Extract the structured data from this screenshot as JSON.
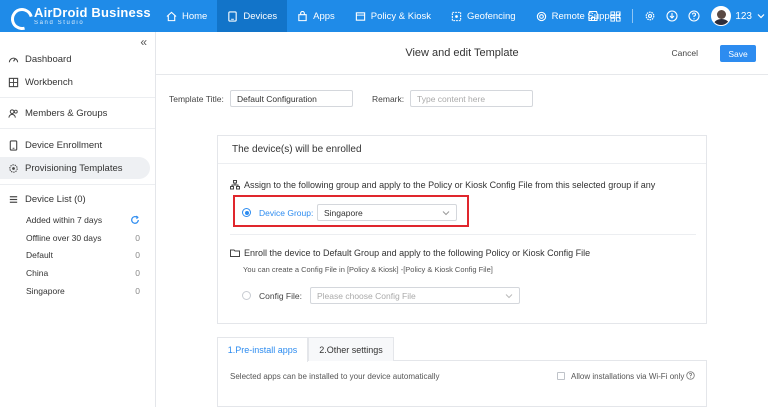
{
  "brand": {
    "name": "AirDroid Business",
    "sub": "Sand Studio"
  },
  "nav": [
    {
      "label": "Home",
      "icon": "home-icon"
    },
    {
      "label": "Devices",
      "icon": "devices-icon",
      "active": true
    },
    {
      "label": "Apps",
      "icon": "apps-icon"
    },
    {
      "label": "Policy & Kiosk",
      "icon": "policy-icon"
    },
    {
      "label": "Geofencing",
      "icon": "geofencing-icon"
    },
    {
      "label": "Remote Support",
      "icon": "remote-support-icon"
    }
  ],
  "user": {
    "name": "123"
  },
  "sidebar": {
    "items": [
      {
        "label": "Dashboard",
        "icon": "dashboard-icon"
      },
      {
        "label": "Workbench",
        "icon": "workbench-icon"
      },
      {
        "label": "Members & Groups",
        "icon": "members-icon"
      },
      {
        "label": "Device Enrollment",
        "icon": "enrollment-icon"
      },
      {
        "label": "Provisioning Templates",
        "icon": "templates-icon",
        "active": true
      },
      {
        "label": "Device List (0)",
        "icon": "device-list-icon"
      }
    ],
    "device_groups": [
      {
        "label": "Added within 7 days",
        "count": ""
      },
      {
        "label": "Offline over 30 days",
        "count": "0"
      },
      {
        "label": "Default",
        "count": "0"
      },
      {
        "label": "China",
        "count": "0"
      },
      {
        "label": "Singapore",
        "count": "0"
      }
    ]
  },
  "header": {
    "title": "View and edit Template",
    "cancel_label": "Cancel",
    "save_label": "Save"
  },
  "form": {
    "template_title_label": "Template Title:",
    "template_title_value": "Default Configuration",
    "remark_label": "Remark:",
    "remark_placeholder": "Type content here"
  },
  "enroll": {
    "heading": "The device(s) will be enrolled",
    "option1_text": "Assign to the following group and apply to the Policy or Kiosk Config File from this selected group if any",
    "device_group_label": "Device Group:",
    "device_group_value": "Singapore",
    "option2_text": "Enroll the device to Default Group and apply to the following Policy or Kiosk Config File",
    "option2_hint": "You can create a Config File in [Policy & Kiosk] -[Policy & Kiosk Config File]",
    "config_file_label": "Config File:",
    "config_file_placeholder": "Please choose Config File"
  },
  "tabs": [
    {
      "label": "1.Pre-install apps",
      "active": true
    },
    {
      "label": "2.Other settings"
    }
  ],
  "preinstall": {
    "description": "Selected apps can be installed to your device automatically",
    "wifi_label": "Allow installations via Wi-Fi only"
  },
  "colors": {
    "primary": "#1f8be8",
    "accent": "#2d8cf0",
    "highlight": "#e0262d"
  }
}
